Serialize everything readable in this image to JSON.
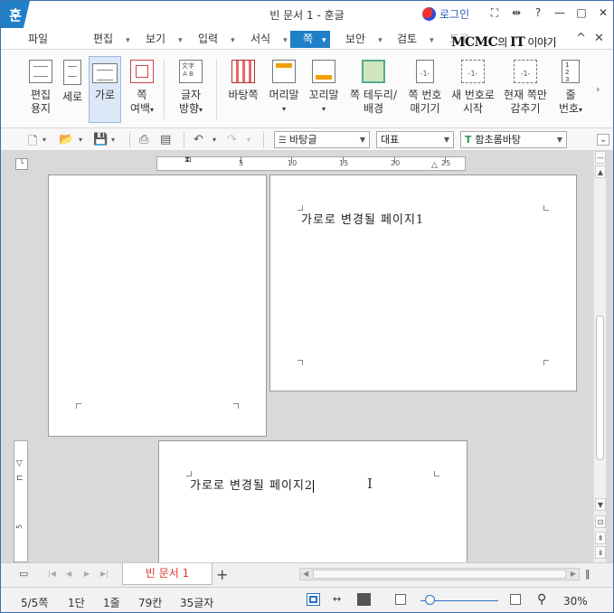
{
  "titlebar": {
    "app_logo": "훈",
    "title": "빈 문서 1 - 훈글",
    "login": "로그인",
    "icons": [
      "expand-icon",
      "split-icon",
      "help-icon",
      "minimize-icon",
      "maximize-icon",
      "close-icon"
    ],
    "icon_glyphs": [
      "⛶",
      "⇹",
      "?",
      "—",
      "□",
      "✕"
    ]
  },
  "menubar": {
    "items": [
      {
        "label": "파일",
        "caret": false
      },
      {
        "label": "편집",
        "caret": true
      },
      {
        "label": "보기",
        "caret": true
      },
      {
        "label": "입력",
        "caret": true
      },
      {
        "label": "서식",
        "caret": true
      },
      {
        "label": "쪽",
        "caret": true,
        "active": true
      },
      {
        "label": "보안",
        "caret": true
      },
      {
        "label": "검토",
        "caret": true
      },
      {
        "label": "도구",
        "caret": true
      }
    ],
    "watermark": {
      "part1": "MCMC",
      "part2": "의 ",
      "part3": "IT",
      "part4": " 이야기"
    },
    "controls": [
      "^",
      "✕"
    ]
  },
  "ribbon": {
    "buttons": [
      {
        "id": "edit-paper",
        "label1": "편집",
        "label2": "용지"
      },
      {
        "id": "portrait",
        "label1": "세로",
        "label2": ""
      },
      {
        "id": "landscape",
        "label1": "가로",
        "label2": "",
        "selected": true
      },
      {
        "id": "page-margin",
        "label1": "쪽",
        "label2": "여백"
      },
      {
        "id": "text-direction",
        "label1": "글자",
        "label2": "방향"
      },
      {
        "id": "page-background",
        "label1": "바탕쪽",
        "label2": ""
      },
      {
        "id": "header",
        "label1": "머리말",
        "label2": ""
      },
      {
        "id": "footer",
        "label1": "꼬리말",
        "label2": ""
      },
      {
        "id": "page-border",
        "label1": "쪽 테두리/",
        "label2": "배경"
      },
      {
        "id": "page-number",
        "label1": "쪽 번호",
        "label2": "매기기"
      },
      {
        "id": "new-number",
        "label1": "새 번호로",
        "label2": "시작"
      },
      {
        "id": "hide-page",
        "label1": "현재 쪽만",
        "label2": "감추기"
      },
      {
        "id": "line-number",
        "label1": "줄",
        "label2": "번호"
      }
    ]
  },
  "toolbar": {
    "style_select": "바탕글",
    "outline_select": "대표",
    "font_select": "함초롬바탕"
  },
  "ruler": {
    "top_labels": [
      "5",
      "10",
      "15",
      "20",
      "25"
    ],
    "left_labels": [
      "5"
    ]
  },
  "document": {
    "page1_text": "가로로 변경될 페이지1",
    "page2_text": "가로로 변경될 페이지2"
  },
  "tabs": {
    "doc_tab": "빈 문서 1",
    "add": "+"
  },
  "status": {
    "page": "5/5쪽",
    "column": "1단",
    "line": "1줄",
    "col": "79칸",
    "chars": "35글자",
    "zoom": "30%",
    "zoom_fraction": 0.12
  }
}
